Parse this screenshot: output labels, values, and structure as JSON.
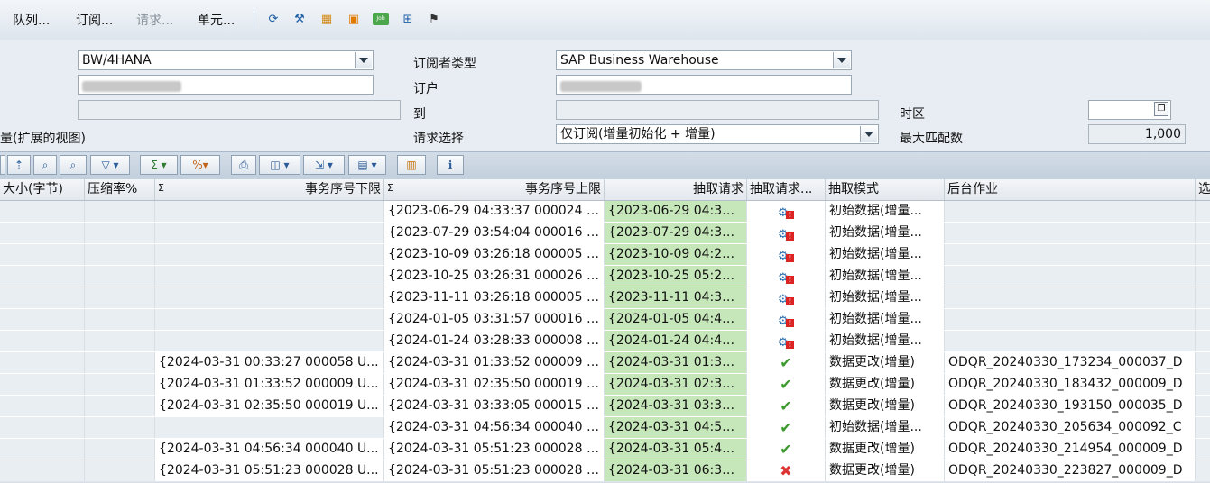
{
  "menu": {
    "queue": "队列...",
    "subscription": "订阅...",
    "request": "请求...",
    "unit": "单元..."
  },
  "form": {
    "context_value": "BW/4HANA",
    "subscriber_type_label": "订阅者类型",
    "subscriber_type_value": "SAP Business Warehouse",
    "subscriber_label": "订户",
    "to_label": "到",
    "timezone_label": "时区",
    "left_label": "量(扩展的视图)",
    "request_select_label": "请求选择",
    "request_select_value": "仅订阅(增量初始化 + 增量)",
    "max_matches_label": "最大匹配数",
    "max_matches_value": "1,000"
  },
  "table": {
    "headers": {
      "size": "大小(字节)",
      "compression": "压缩率%",
      "seq_low": "事务序号下限",
      "seq_high": "事务序号上限",
      "extract_req": "抽取请求",
      "extract_status": "抽取请求...",
      "mode": "抽取模式",
      "job": "后台作业",
      "extra": "选"
    },
    "sigma": "Σ",
    "rows": [
      {
        "low": "",
        "high": "{2023-06-29 04:33:37 000024 U...",
        "req": "{2023-06-29 04:33:...",
        "status": "error-gear",
        "mode": "初始数据(增量...",
        "job": ""
      },
      {
        "low": "",
        "high": "{2023-07-29 03:54:04 000016 U...",
        "req": "{2023-07-29 04:30:...",
        "status": "error-gear",
        "mode": "初始数据(增量...",
        "job": ""
      },
      {
        "low": "",
        "high": "{2023-10-09 03:26:18 000005 U...",
        "req": "{2023-10-09 04:28:...",
        "status": "error-gear",
        "mode": "初始数据(增量...",
        "job": ""
      },
      {
        "low": "",
        "high": "{2023-10-25 03:26:31 000026 U...",
        "req": "{2023-10-25 05:26:...",
        "status": "error-gear",
        "mode": "初始数据(增量...",
        "job": ""
      },
      {
        "low": "",
        "high": "{2023-11-11 03:26:18 000005 U...",
        "req": "{2023-11-11 04:31:...",
        "status": "error-gear",
        "mode": "初始数据(增量...",
        "job": ""
      },
      {
        "low": "",
        "high": "{2024-01-05 03:31:57 000016 U...",
        "req": "{2024-01-05 04:48:...",
        "status": "error-gear",
        "mode": "初始数据(增量...",
        "job": ""
      },
      {
        "low": "",
        "high": "{2024-01-24 03:28:33 000008 U...",
        "req": "{2024-01-24 04:46:...",
        "status": "error-gear",
        "mode": "初始数据(增量...",
        "job": ""
      },
      {
        "low": "{2024-03-31 00:33:27 000058 U...",
        "high": "{2024-03-31 01:33:52 000009 U...",
        "req": "{2024-03-31 01:32:...",
        "status": "check",
        "mode": "数据更改(增量)",
        "job": "ODQR_20240330_173234_000037_D"
      },
      {
        "low": "{2024-03-31 01:33:52 000009 U...",
        "high": "{2024-03-31 02:35:50 000019 U...",
        "req": "{2024-03-31 02:34:...",
        "status": "check",
        "mode": "数据更改(增量)",
        "job": "ODQR_20240330_183432_000009_D"
      },
      {
        "low": "{2024-03-31 02:35:50 000019 U...",
        "high": "{2024-03-31 03:33:05 000015 U...",
        "req": "{2024-03-31 03:31:...",
        "status": "check",
        "mode": "数据更改(增量)",
        "job": "ODQR_20240330_193150_000035_D"
      },
      {
        "low": "",
        "high": "{2024-03-31 04:56:34 000040 U...",
        "req": "{2024-03-31 04:56:...",
        "status": "check",
        "mode": "初始数据(增量...",
        "job": "ODQR_20240330_205634_000092_C"
      },
      {
        "low": "{2024-03-31 04:56:34 000040 U...",
        "high": "{2024-03-31 05:51:23 000028 U...",
        "req": "{2024-03-31 05:49:...",
        "status": "check",
        "mode": "数据更改(增量)",
        "job": "ODQR_20240330_214954_000009_D"
      },
      {
        "low": "{2024-03-31 05:51:23 000028 U...",
        "high": "{2024-03-31 05:51:23 000028 U...",
        "req": "{2024-03-31 06:38:...",
        "status": "cross",
        "mode": "数据更改(增量)",
        "job": "ODQR_20240330_223827_000009_D"
      }
    ]
  }
}
